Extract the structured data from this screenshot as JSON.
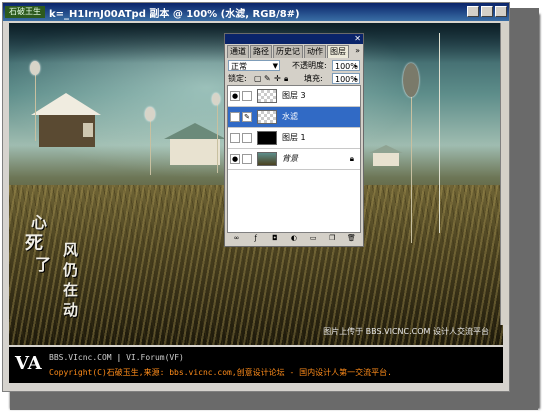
{
  "window": {
    "icon_label": "石破王生",
    "title": "k=_H1IrnJ00ATpd 副本 @ 100% (水滤, RGB/8#)"
  },
  "photo": {
    "calligraphy": [
      "心",
      "死",
      "了",
      "风",
      "仍",
      "在",
      "动"
    ],
    "upload_caption": "图片上传于 BBS.VICNC.COM 设计人交流平台"
  },
  "layers_panel": {
    "tabs": [
      "通道",
      "路径",
      "历史记",
      "动作",
      "图层"
    ],
    "active_tab": 4,
    "more_label": "»",
    "blend_mode": "正常",
    "opacity_label": "不透明度:",
    "opacity_value": "100%",
    "lock_label": "锁定:",
    "fill_label": "填充:",
    "fill_value": "100%",
    "layers": [
      {
        "name": "图层 3",
        "visible": true,
        "thumb": "checker",
        "selected": false,
        "italic": false
      },
      {
        "name": "水滤",
        "visible": false,
        "thumb": "checker",
        "selected": true,
        "italic": false
      },
      {
        "name": "图层 1",
        "visible": false,
        "thumb": "black",
        "selected": false,
        "italic": false
      },
      {
        "name": "背景",
        "visible": true,
        "thumb": "photo",
        "selected": false,
        "italic": true,
        "locked": true
      }
    ]
  },
  "footer": {
    "logo": "VA",
    "line1_a": "BBS.VIcnc.COM",
    "line1_sep": " | ",
    "line1_b": "VI.Forum(VF)",
    "line2": "Copyright(C)石破玉生,来源: bbs.vicnc.com,创意设计论坛 - 国内设计人第一交流平台."
  },
  "colors": {
    "titlebar": "#0a246a",
    "selection": "#316ac5",
    "footer_accent": "#ff8c1a"
  }
}
